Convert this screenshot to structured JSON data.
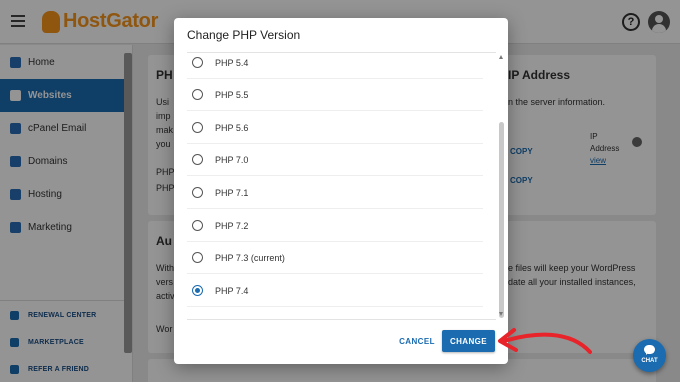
{
  "header": {
    "logo_text": "HostGator",
    "help_icon_glyph": "?",
    "icons": [
      "menu-icon",
      "help-icon",
      "account-icon"
    ]
  },
  "sidebar": {
    "items": [
      {
        "label": "Home",
        "icon": "home-icon",
        "active": false
      },
      {
        "label": "Websites",
        "icon": "websites-icon",
        "active": true
      },
      {
        "label": "cPanel Email",
        "icon": "email-icon",
        "active": false
      },
      {
        "label": "Domains",
        "icon": "domains-icon",
        "active": false
      },
      {
        "label": "Hosting",
        "icon": "hosting-icon",
        "active": false
      },
      {
        "label": "Marketing",
        "icon": "marketing-icon",
        "active": false
      }
    ],
    "bottom_links": [
      {
        "label": "RENEWAL CENTER",
        "icon": "renewal-icon"
      },
      {
        "label": "MARKETPLACE",
        "icon": "marketplace-icon"
      },
      {
        "label": "REFER A FRIEND",
        "icon": "refer-icon"
      }
    ]
  },
  "background": {
    "php_card_title": "PH",
    "php_card_lines": [
      "Usi",
      "imp",
      "mak",
      "you"
    ],
    "php_rows": [
      "PHP",
      "PHP"
    ],
    "ip_card_title": "IP Address",
    "ip_card_desc": "n the server information.",
    "copy_label": "COPY",
    "ip_label_1": "IP",
    "ip_label_2": "Address",
    "ip_link": "view",
    "auto_card_title": "Au",
    "auto_lines_left": [
      "With",
      "vers",
      "activ"
    ],
    "auto_lines_right": [
      "e files will keep your WordPress",
      "date all your installed instances,"
    ],
    "auto_row": "Wor"
  },
  "modal": {
    "title": "Change PHP Version",
    "options": [
      {
        "label": "PHP 5.4",
        "checked": false
      },
      {
        "label": "PHP 5.5",
        "checked": false
      },
      {
        "label": "PHP 5.6",
        "checked": false
      },
      {
        "label": "PHP 7.0",
        "checked": false
      },
      {
        "label": "PHP 7.1",
        "checked": false
      },
      {
        "label": "PHP 7.2",
        "checked": false
      },
      {
        "label": "PHP 7.3 (current)",
        "checked": false
      },
      {
        "label": "PHP 7.4",
        "checked": true
      }
    ],
    "cancel_label": "CANCEL",
    "change_label": "CHANGE"
  },
  "chat": {
    "label": "CHAT"
  },
  "colors": {
    "accent": "#1a6bb0",
    "brand": "#f7941d",
    "annotation": "#e8232a"
  }
}
